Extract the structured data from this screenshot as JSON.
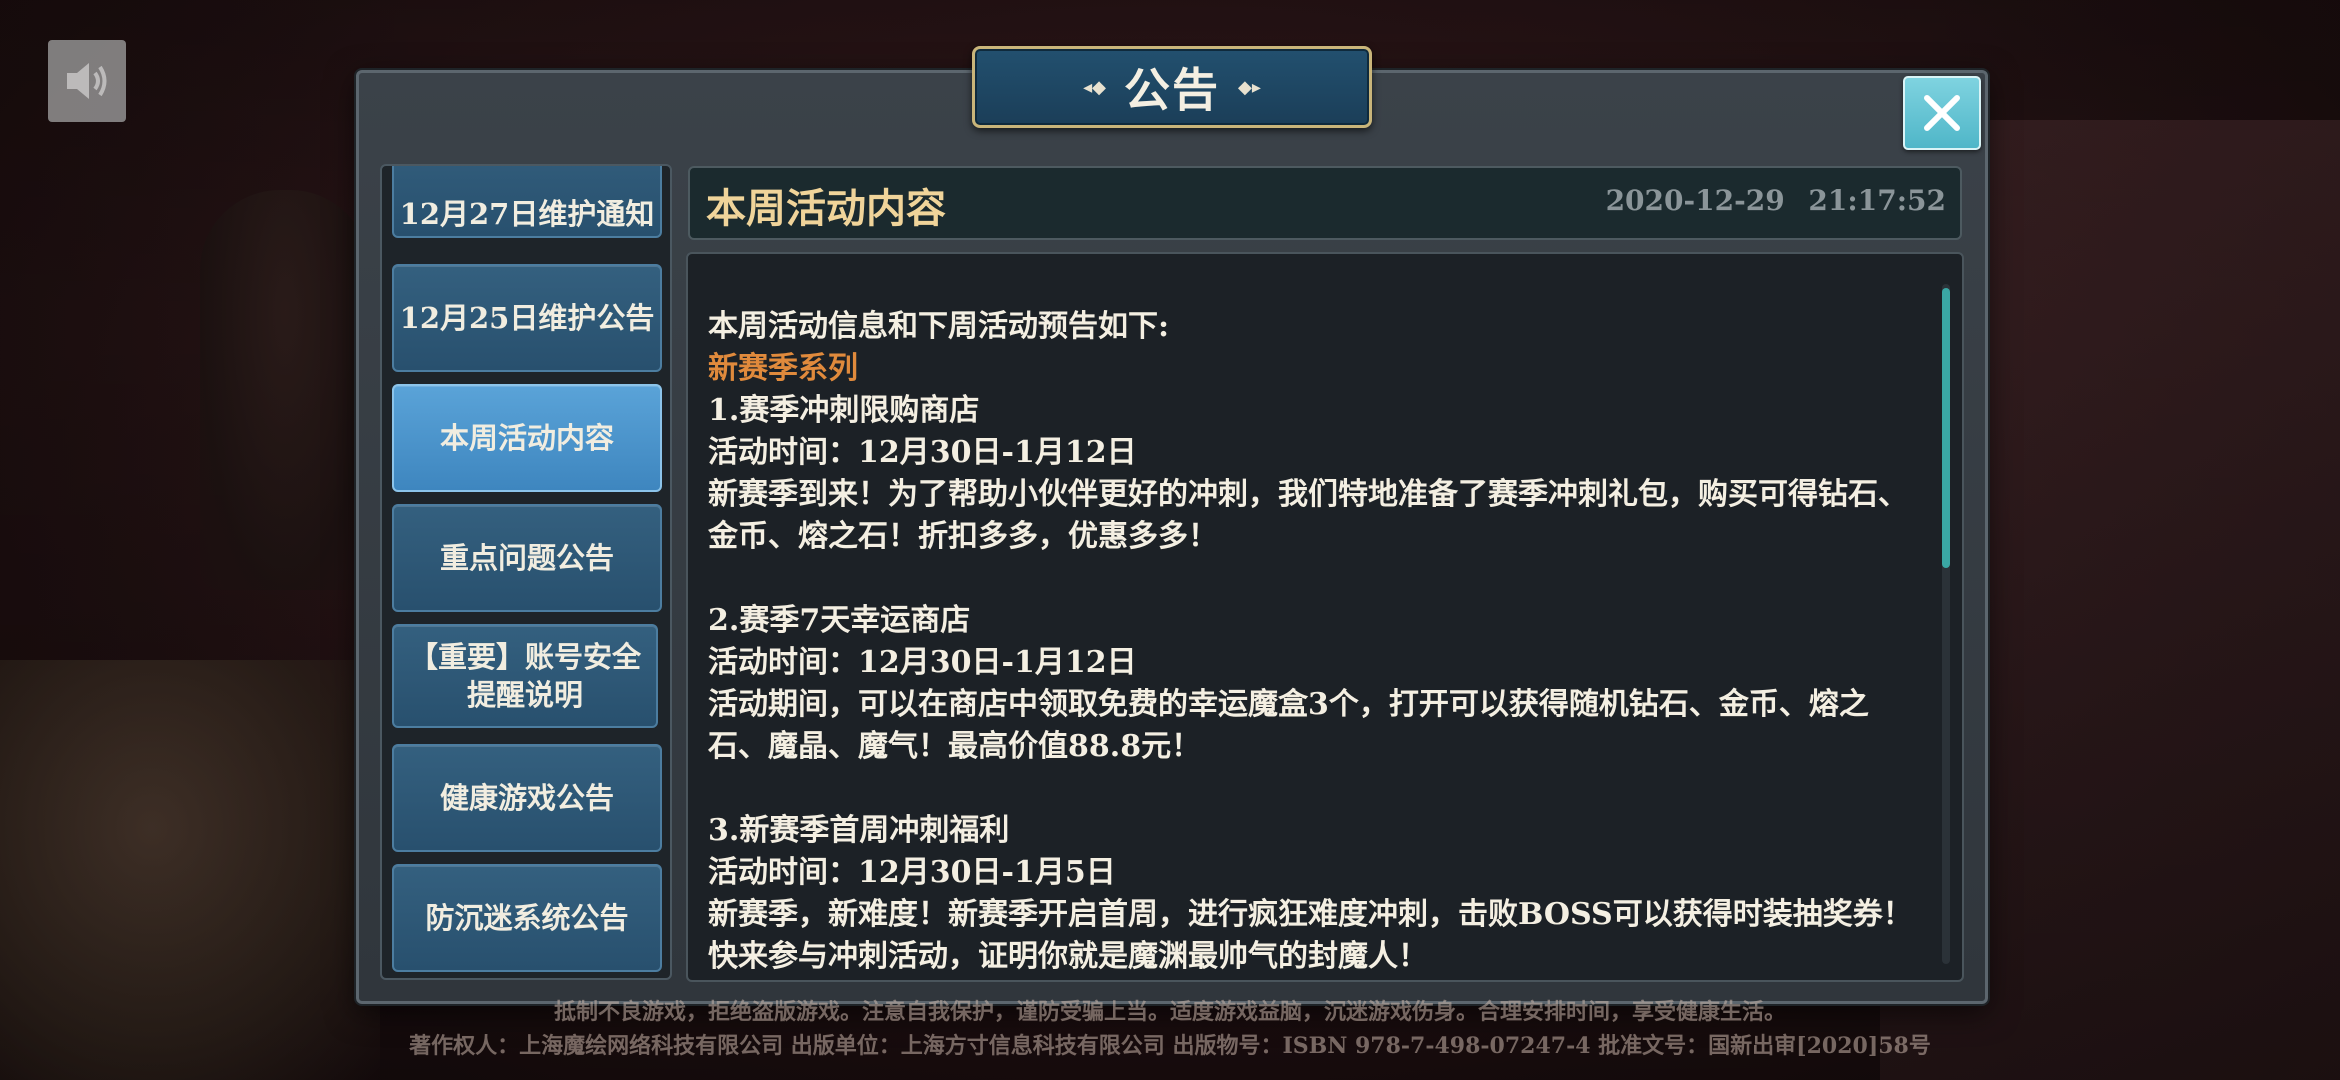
{
  "dialog": {
    "title": "公告",
    "close_icon": "close-icon",
    "sound_icon": "speaker-icon"
  },
  "sidebar": {
    "items": [
      {
        "label": "12月27日维护通知"
      },
      {
        "label": "12月25日维护公告"
      },
      {
        "label": "本周活动内容",
        "active": true
      },
      {
        "label": "重点问题公告"
      },
      {
        "label": "【重要】账号安全提醒说明"
      },
      {
        "label": "健康游戏公告"
      },
      {
        "label": "防沉迷系统公告"
      }
    ]
  },
  "article": {
    "title": "本周活动内容",
    "date": "2020-12-29 21:17:52",
    "lines": [
      "本周活动信息和下周活动预告如下:",
      "新赛季系列",
      "1.赛季冲刺限购商店",
      "活动时间：12月30日-1月12日",
      "新赛季到来！为了帮助小伙伴更好的冲刺，我们特地准备了赛季冲刺礼包，购买可得钻石、金币、熔之石！折扣多多，优惠多多！",
      "2.赛季7天幸运商店",
      "活动时间：12月30日-1月12日",
      "活动期间，可以在商店中领取免费的幸运魔盒3个，打开可以获得随机钻石、金币、熔之石、魔晶、魔气！最高价值88.8元！",
      "3.新赛季首周冲刺福利",
      "活动时间：12月30日-1月5日",
      "新赛季，新难度！新赛季开启首周，进行疯狂难度冲刺，击败BOSS可以获得时装抽奖券！快来参与冲刺活动，证明你就是魔渊最帅气的封魔人！"
    ],
    "accent_color": "#e08a3c"
  },
  "footer": {
    "line1": "抵制不良游戏，拒绝盗版游戏。注意自我保护，谨防受骗上当。适度游戏益脑，沉迷游戏伤身。合理安排时间，享受健康生活。",
    "line2": "著作权人：上海魔绘网络科技有限公司 出版单位：上海方寸信息科技有限公司 出版物号：ISBN 978-7-498-07247-4 批准文号：国新出审[2020]58号"
  }
}
